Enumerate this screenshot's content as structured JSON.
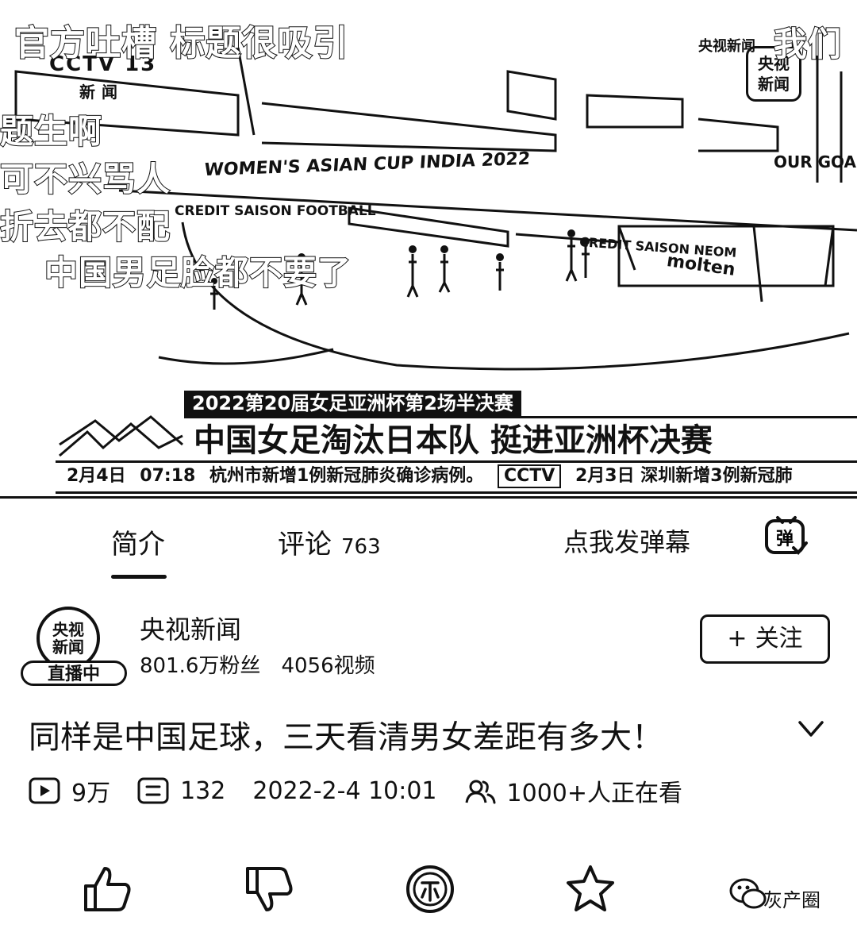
{
  "video": {
    "danmaku": [
      "官方吐槽 标题很吸引",
      "题生啊",
      "可不兴骂人",
      "折去都不配",
      "中国男足脸都不要了",
      "我们"
    ],
    "channel_overlay": "CCTV 13",
    "channel_overlay_sub": "新闻",
    "logo_top": "央视新闻",
    "logo_box": "央视新闻",
    "stadium_banner": "WOMEN'S ASIAN CUP INDIA 2022",
    "stadium_text_right": "OUR GOAL",
    "ad_board_1": "CREDIT SAISON  FOOTBALL",
    "ad_board_2": "CREDIT SAISON  NEOM",
    "ad_board_3": "molten",
    "lower_third_tag": "2022第20届女足亚洲杯第2场半决赛",
    "lower_third_title": "中国女足淘汰日本队 挺进亚洲杯决赛",
    "ticker_date": "2月4日",
    "ticker_time": "07:18",
    "ticker_text_1": "杭州市新增1例新冠肺炎确诊病例。",
    "ticker_logo": "CCTV",
    "ticker_text_2": "2月3日 深圳新增3例新冠肺"
  },
  "tabs": {
    "intro": "简介",
    "comments": "评论",
    "comments_count": "763",
    "danmaku_placeholder": "点我发弹幕",
    "danmaku_btn": "弹"
  },
  "uploader": {
    "avatar_text": "央视新闻",
    "live_badge": "直播中",
    "name": "央视新闻",
    "fans": "801.6万粉丝",
    "videos": "4056视频",
    "follow_plus": "+",
    "follow": "关注"
  },
  "video_title": "同样是中国足球，三天看清男女差距有多大！",
  "meta": {
    "plays": "9万",
    "danmaku_count": "132",
    "date": "2022-2-4 10:01",
    "watching": "1000+人正在看"
  },
  "watermark": "灰产圈",
  "icons": [
    "play-icon",
    "danmaku-list-icon",
    "people-icon",
    "like-icon",
    "dislike-icon",
    "coin-icon",
    "favorite-icon",
    "share-icon",
    "expand-icon"
  ]
}
